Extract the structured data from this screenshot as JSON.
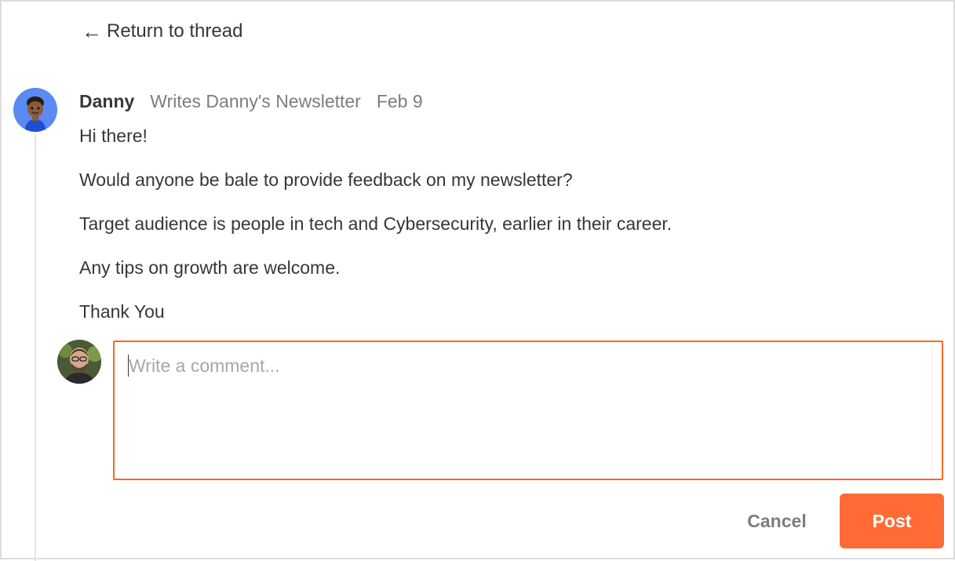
{
  "nav": {
    "back_arrow": "←",
    "back_label": "Return to thread"
  },
  "post": {
    "author": "Danny",
    "byline": "Writes Danny's Newsletter",
    "date": "Feb 9",
    "paragraphs": [
      "Hi there!",
      "Would anyone be bale to provide feedback on my newsletter?",
      "Target audience is people in tech and Cybersecurity, earlier in their career.",
      "Any tips on growth are welcome.",
      "Thank You"
    ]
  },
  "comment": {
    "placeholder": "Write a comment...",
    "value": ""
  },
  "actions": {
    "cancel_label": "Cancel",
    "post_label": "Post"
  },
  "colors": {
    "accent": "#ff6719",
    "post_button": "#ff6b35",
    "text": "#363737",
    "muted": "#7d7d7d"
  },
  "icons": {
    "author_avatar": "avatar-illustration",
    "user_avatar": "avatar-photo"
  }
}
